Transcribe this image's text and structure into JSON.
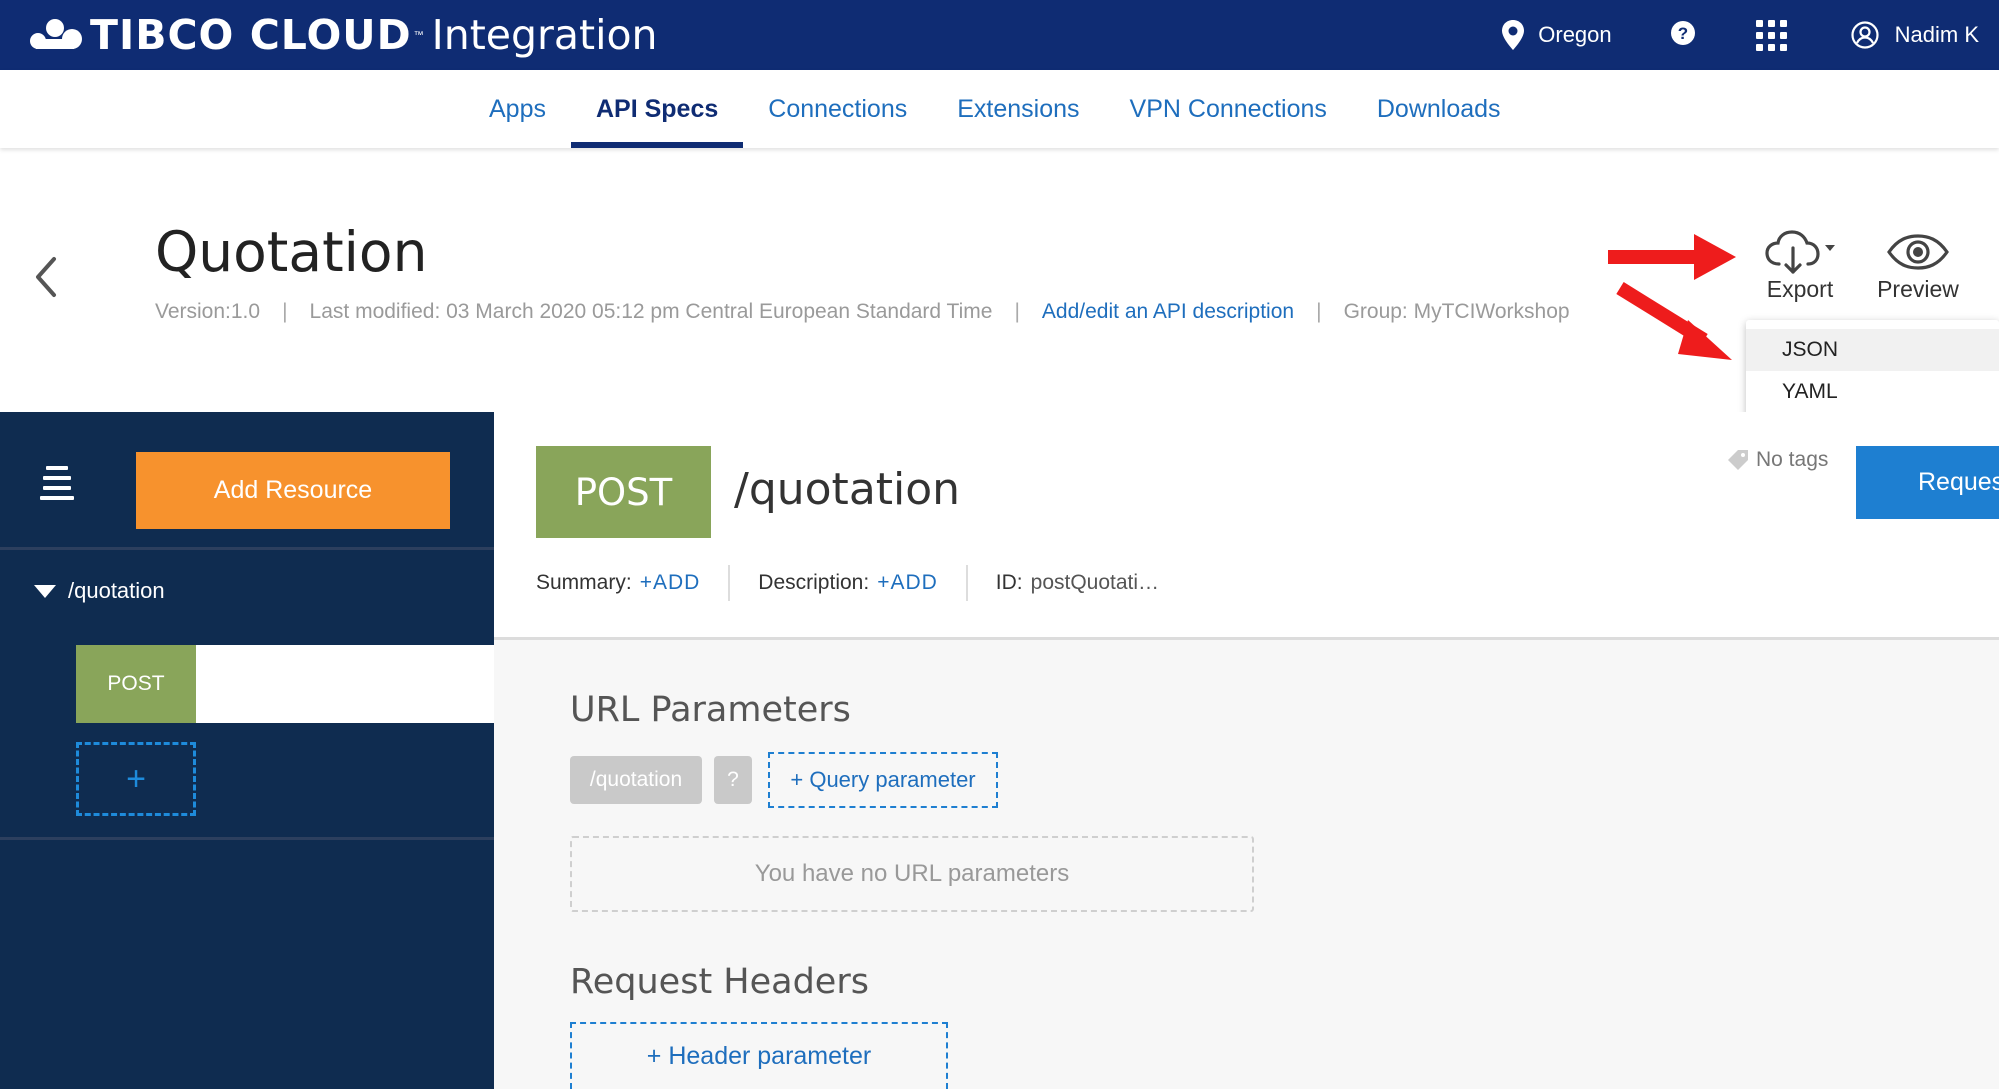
{
  "header": {
    "brand": "TIBCO CLOUD",
    "brand_tm": "™",
    "product": "Integration",
    "region": "Oregon",
    "user": "Nadim K",
    "icons": [
      "location-pin-icon",
      "help-icon",
      "app-grid-icon",
      "user-icon"
    ]
  },
  "nav": {
    "tabs": [
      {
        "label": "Apps"
      },
      {
        "label": "API Specs"
      },
      {
        "label": "Connections"
      },
      {
        "label": "Extensions"
      },
      {
        "label": "VPN Connections"
      },
      {
        "label": "Downloads"
      }
    ],
    "active": "API Specs"
  },
  "spec": {
    "title": "Quotation",
    "version": "Version:1.0",
    "last_modified": "Last modified: 03 March 2020 05:12 pm Central European Standard Time",
    "description_link": "Add/edit an API description",
    "group": "Group: MyTCIWorkshop",
    "separator": "|"
  },
  "actions": {
    "export_label": "Export",
    "preview_label": "Preview",
    "export_menu": [
      "JSON",
      "YAML"
    ]
  },
  "sidebar": {
    "add_resource_label": "Add Resource",
    "resource_path": "/quotation",
    "method": "POST",
    "add_method_label": "+"
  },
  "operation": {
    "method": "POST",
    "path": "/quotation",
    "summary_label": "Summary:",
    "summary_add": "+ADD",
    "description_label": "Description:",
    "description_add": "+ADD",
    "id_label": "ID:",
    "id_value": "postQuotati…",
    "tags": "No tags",
    "request_btn": "Reques"
  },
  "url_params": {
    "title": "URL Parameters",
    "path_chip": "/quotation",
    "query_chip": "?",
    "add_query": "+ Query parameter",
    "empty_text": "You have no URL parameters"
  },
  "request_headers": {
    "title": "Request Headers",
    "add_header": "+  Header parameter"
  },
  "colors": {
    "topbar": "#0f2c73",
    "accent_orange": "#f7922d",
    "post_green": "#89a55a",
    "link_blue": "#1e6ebd",
    "sidebar": "#0f2c50"
  }
}
